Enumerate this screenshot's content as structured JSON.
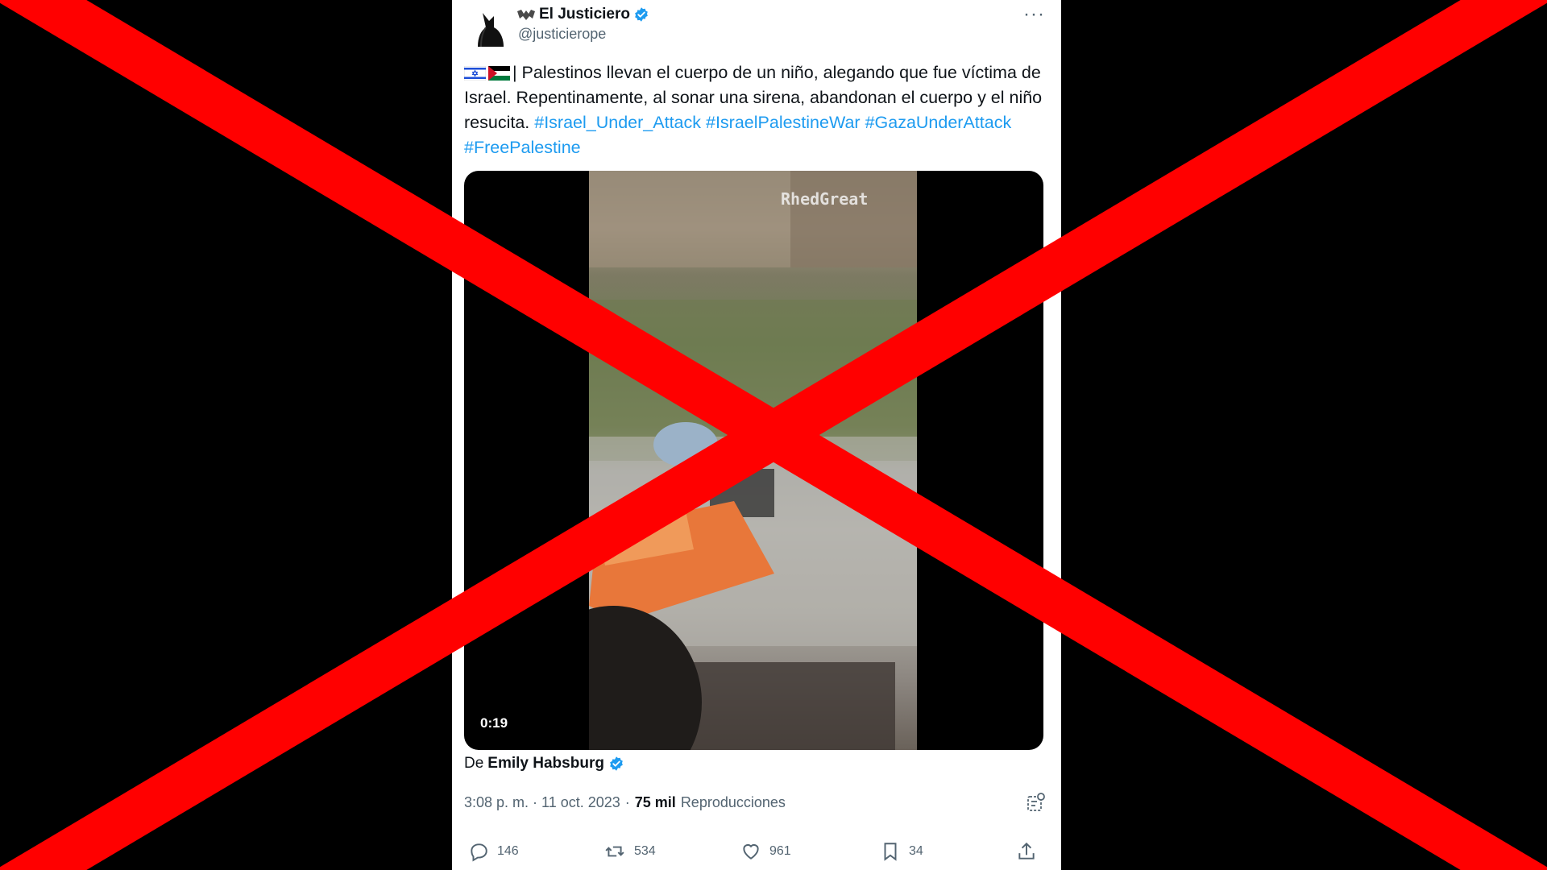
{
  "tweet": {
    "display_name": "El Justiciero",
    "handle": "@justicierope",
    "more_label": "···",
    "text_prefix": "| Palestinos llevan el cuerpo de un niño, alegando que fue víctima de Israel. Repentinamente, al sonar una sirena, abandonan el cuerpo y el niño resucita.",
    "hashtags": [
      "#Israel_Under_Attack",
      "#IsraelPalestineWar",
      "#GazaUnderAttack",
      "#FreePalestine"
    ],
    "media": {
      "watermark": "RhedGreat",
      "duration": "0:19"
    },
    "source_prefix": "De",
    "source_name": "Emily Habsburg",
    "timestamp": "3:08 p. m. · 11 oct. 2023",
    "meta_sep": "·",
    "views_count": "75 mil",
    "views_label": "Reproducciones",
    "stats": {
      "replies": "146",
      "retweets": "534",
      "likes": "961",
      "bookmarks": "34"
    }
  },
  "colors": {
    "overlay_cross": "#ff0000",
    "link": "#1d9bf0",
    "verified": "#1d9bf0",
    "muted": "#536471"
  },
  "icons": [
    "avatar-silhouette",
    "bat-emoji",
    "verified-badge-icon",
    "israel-flag-icon",
    "palestine-flag-icon",
    "reply-icon",
    "retweet-icon",
    "like-icon",
    "bookmark-icon",
    "share-icon",
    "analytics-icon",
    "more-icon"
  ]
}
